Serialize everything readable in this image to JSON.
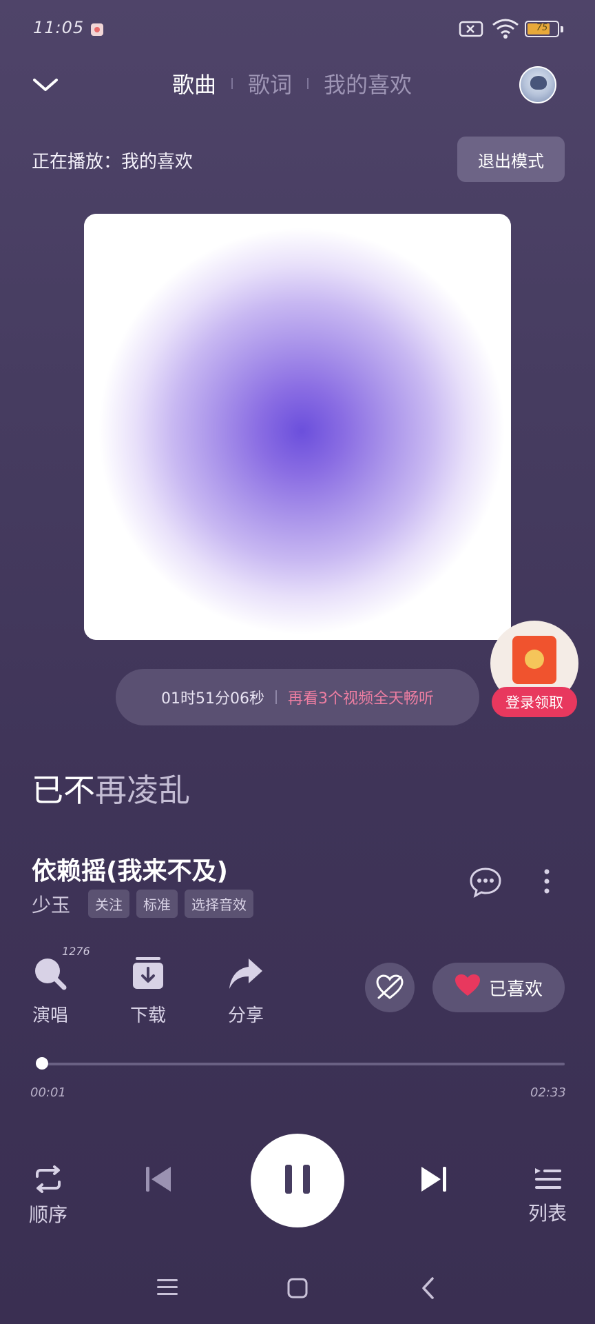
{
  "status_bar": {
    "time": "11:05",
    "battery_level": "75",
    "battery_fraction": 0.75,
    "icons": [
      "notification-icon",
      "sim-icon",
      "wifi-icon",
      "battery-icon"
    ]
  },
  "header": {
    "tabs": [
      {
        "label": "歌曲",
        "active": true
      },
      {
        "label": "歌词",
        "active": false
      },
      {
        "label": "我的喜欢",
        "active": false
      }
    ],
    "collapse_icon": "chevron-down-icon",
    "avatar_icon": "avatar-icon"
  },
  "playback_source": {
    "now_playing": "正在播放：我的喜欢",
    "exit_mode_label": "退出模式"
  },
  "timer_banner": {
    "remaining": "01时51分06秒",
    "promo": "再看3个视频全天畅听"
  },
  "red_packet": {
    "label": "登录领取"
  },
  "lyric": {
    "sung": "已不",
    "unsung": "再凌乱"
  },
  "song": {
    "title": "依赖摇(我来不及)",
    "artist": "少玉",
    "tags": [
      "关注",
      "标准",
      "选择音效"
    ]
  },
  "actions": {
    "sing_label": "演唱",
    "sing_count": "1276",
    "download_label": "下载",
    "share_label": "分享",
    "liked_label": "已喜欢"
  },
  "progress": {
    "current": "00:01",
    "total": "02:33",
    "fraction": 0.007
  },
  "controls": {
    "mode_label": "顺序",
    "list_label": "列表",
    "state": "playing"
  },
  "colors": {
    "accent_pink": "#ee7ea2",
    "heart_red": "#e8385e",
    "background": "#463c60"
  }
}
